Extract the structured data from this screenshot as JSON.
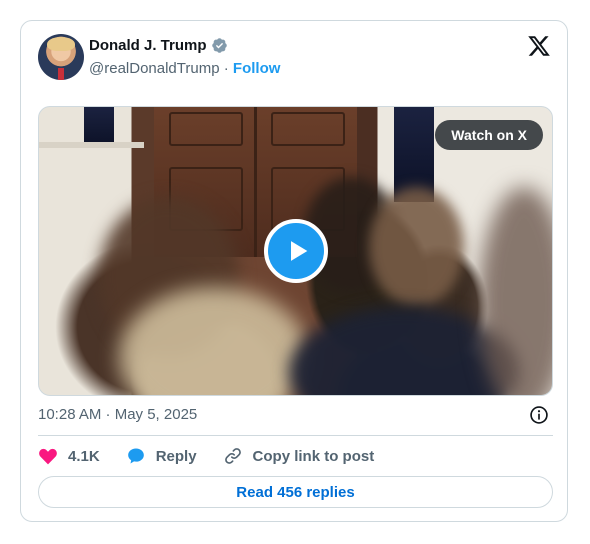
{
  "author": {
    "name": "Donald J. Trump",
    "handle": "@realDonaldTrump",
    "follow_label": "Follow",
    "verified_color": "#829aab"
  },
  "media": {
    "watch_label": "Watch on X",
    "play_icon": "play-icon"
  },
  "tweet": {
    "timestamp": "10:28 AM · May 5, 2025"
  },
  "actions": {
    "like_count": "4.1K",
    "reply_label": "Reply",
    "copy_label": "Copy link to post"
  },
  "replies_label": "Read 456 replies",
  "colors": {
    "accent": "#1d9bf0",
    "like": "#f91880",
    "link": "#006fd6",
    "muted": "#536471"
  }
}
